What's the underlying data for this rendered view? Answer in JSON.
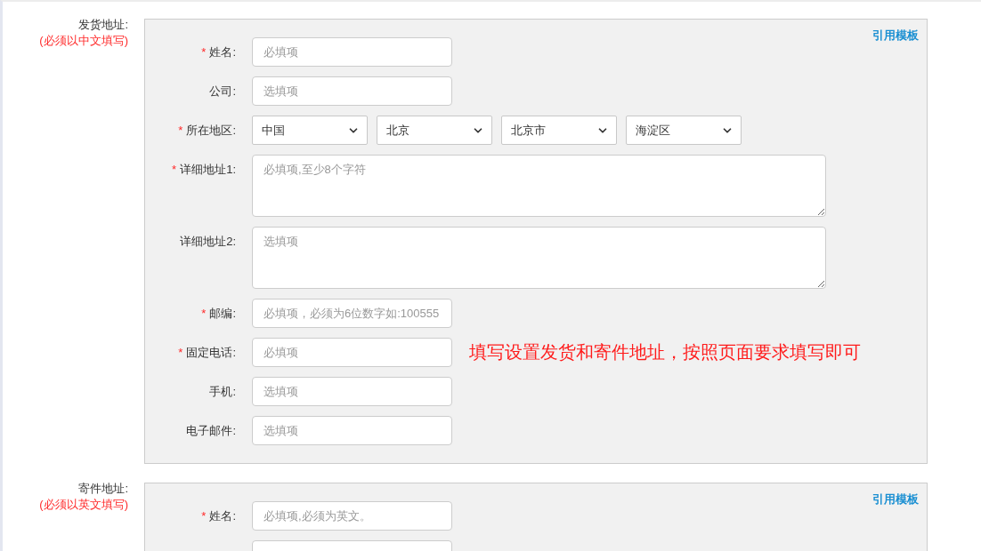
{
  "sections": [
    {
      "label": "发货地址:",
      "note": "(必须以中文填写)",
      "template_link": "引用模板",
      "fields": [
        {
          "kind": "input",
          "required_mark": "*",
          "label": "姓名:",
          "placeholder": "必填项"
        },
        {
          "kind": "input",
          "label": "公司:",
          "placeholder": "选填项"
        },
        {
          "kind": "region",
          "required_mark": "*",
          "label": "所在地区:",
          "values": [
            "中国",
            "北京",
            "北京市",
            "海淀区"
          ]
        },
        {
          "kind": "textarea",
          "required_mark": "*",
          "label": "详细地址1:",
          "placeholder": "必填项,至少8个字符"
        },
        {
          "kind": "textarea",
          "label": "详细地址2:",
          "placeholder": "选填项"
        },
        {
          "kind": "input",
          "required_mark": "*",
          "label": "邮编:",
          "placeholder": "必填项，必须为6位数字如:100555"
        },
        {
          "kind": "input",
          "required_mark": "*",
          "label": "固定电话:",
          "placeholder": "必填项",
          "hint": "填写设置发货和寄件地址，按照页面要求填写即可"
        },
        {
          "kind": "input",
          "label": "手机:",
          "placeholder": "选填项"
        },
        {
          "kind": "input",
          "label": "电子邮件:",
          "placeholder": "选填项"
        }
      ]
    },
    {
      "label": "寄件地址:",
      "note": "(必须以英文填写)",
      "template_link": "引用模板",
      "fields": [
        {
          "kind": "input",
          "required_mark": "*",
          "label": "姓名:",
          "placeholder": "必填项,必须为英文。"
        },
        {
          "kind": "input"
        }
      ]
    }
  ]
}
